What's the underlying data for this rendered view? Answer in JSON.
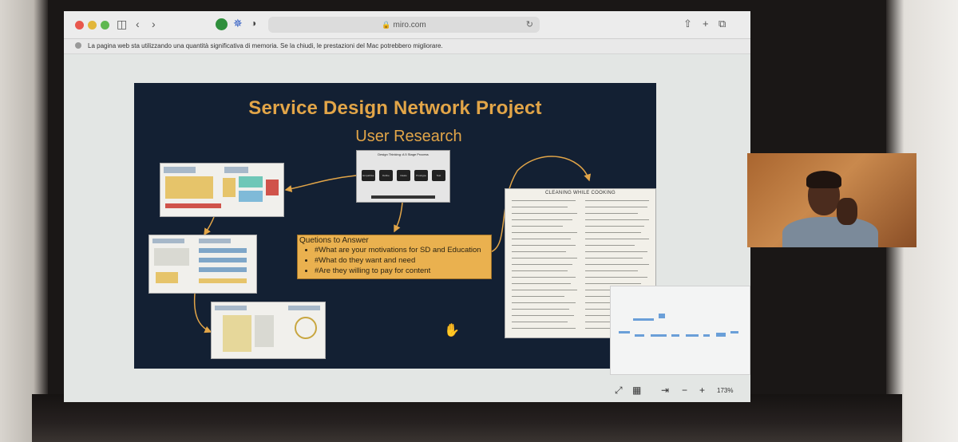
{
  "browser": {
    "url": "miro.com",
    "notice": "La pagina web sta utilizzando una quantità significativa di memoria. Se la chiudi, le prestazioni del Mac potrebbero migliorare."
  },
  "board": {
    "title": "Service Design Network Project",
    "subtitle": "User Research",
    "process_card": {
      "title": "Design Thinking: A 5 Stage Process",
      "stages": [
        "Empathise",
        "Define",
        "Ideate",
        "Prototype",
        "Test"
      ]
    },
    "questions": {
      "title": "Quetions to Answer",
      "items": [
        "#What are your motivations for SD and Education",
        "#What do they want and need",
        "#Are they willing to pay for content"
      ]
    },
    "document_title": "CLEANING WHILE COOKING"
  },
  "zoom": {
    "level": "173%"
  },
  "colors": {
    "board_bg": "#132033",
    "accent": "#e2a548",
    "sticky": "#eab14f"
  }
}
